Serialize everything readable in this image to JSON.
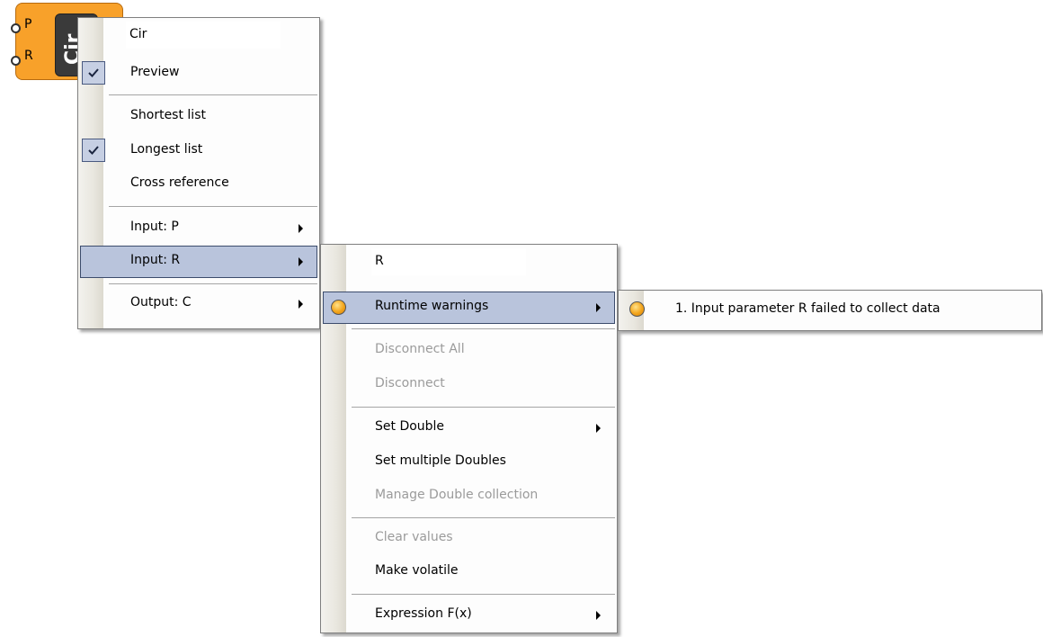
{
  "component": {
    "input_pins": [
      "P",
      "R"
    ],
    "nickname": "Cir"
  },
  "main_menu": {
    "name_field": "Cir",
    "items": [
      {
        "label": "Preview",
        "checked": true
      },
      {
        "label": "Shortest list",
        "checked": false
      },
      {
        "label": "Longest list",
        "checked": true
      },
      {
        "label": "Cross reference",
        "checked": false
      },
      {
        "label": "Input: P",
        "submenu": true
      },
      {
        "label": "Input: R",
        "submenu": true,
        "highlighted": true
      },
      {
        "label": "Output: C",
        "submenu": true
      }
    ]
  },
  "param_menu": {
    "name_field": "R",
    "items": [
      {
        "label": "Runtime warnings",
        "submenu": true,
        "highlighted": true,
        "icon": "warning-dot-icon"
      },
      {
        "label": "Disconnect All",
        "disabled": true
      },
      {
        "label": "Disconnect",
        "disabled": true
      },
      {
        "label": "Set Double",
        "submenu": true
      },
      {
        "label": "Set multiple Doubles"
      },
      {
        "label": "Manage Double collection",
        "disabled": true
      },
      {
        "label": "Clear values",
        "disabled": true
      },
      {
        "label": "Make volatile"
      },
      {
        "label": "Expression F(x)",
        "submenu": true
      }
    ]
  },
  "warnings_menu": {
    "items": [
      {
        "label": "1. Input parameter R failed to collect data",
        "icon": "warning-dot-icon"
      }
    ]
  },
  "colors": {
    "component_orange": "#f8a12a",
    "highlight": "#b9c4dc",
    "highlight_border": "#3c4c6c",
    "disabled_text": "#9b9b9b"
  }
}
